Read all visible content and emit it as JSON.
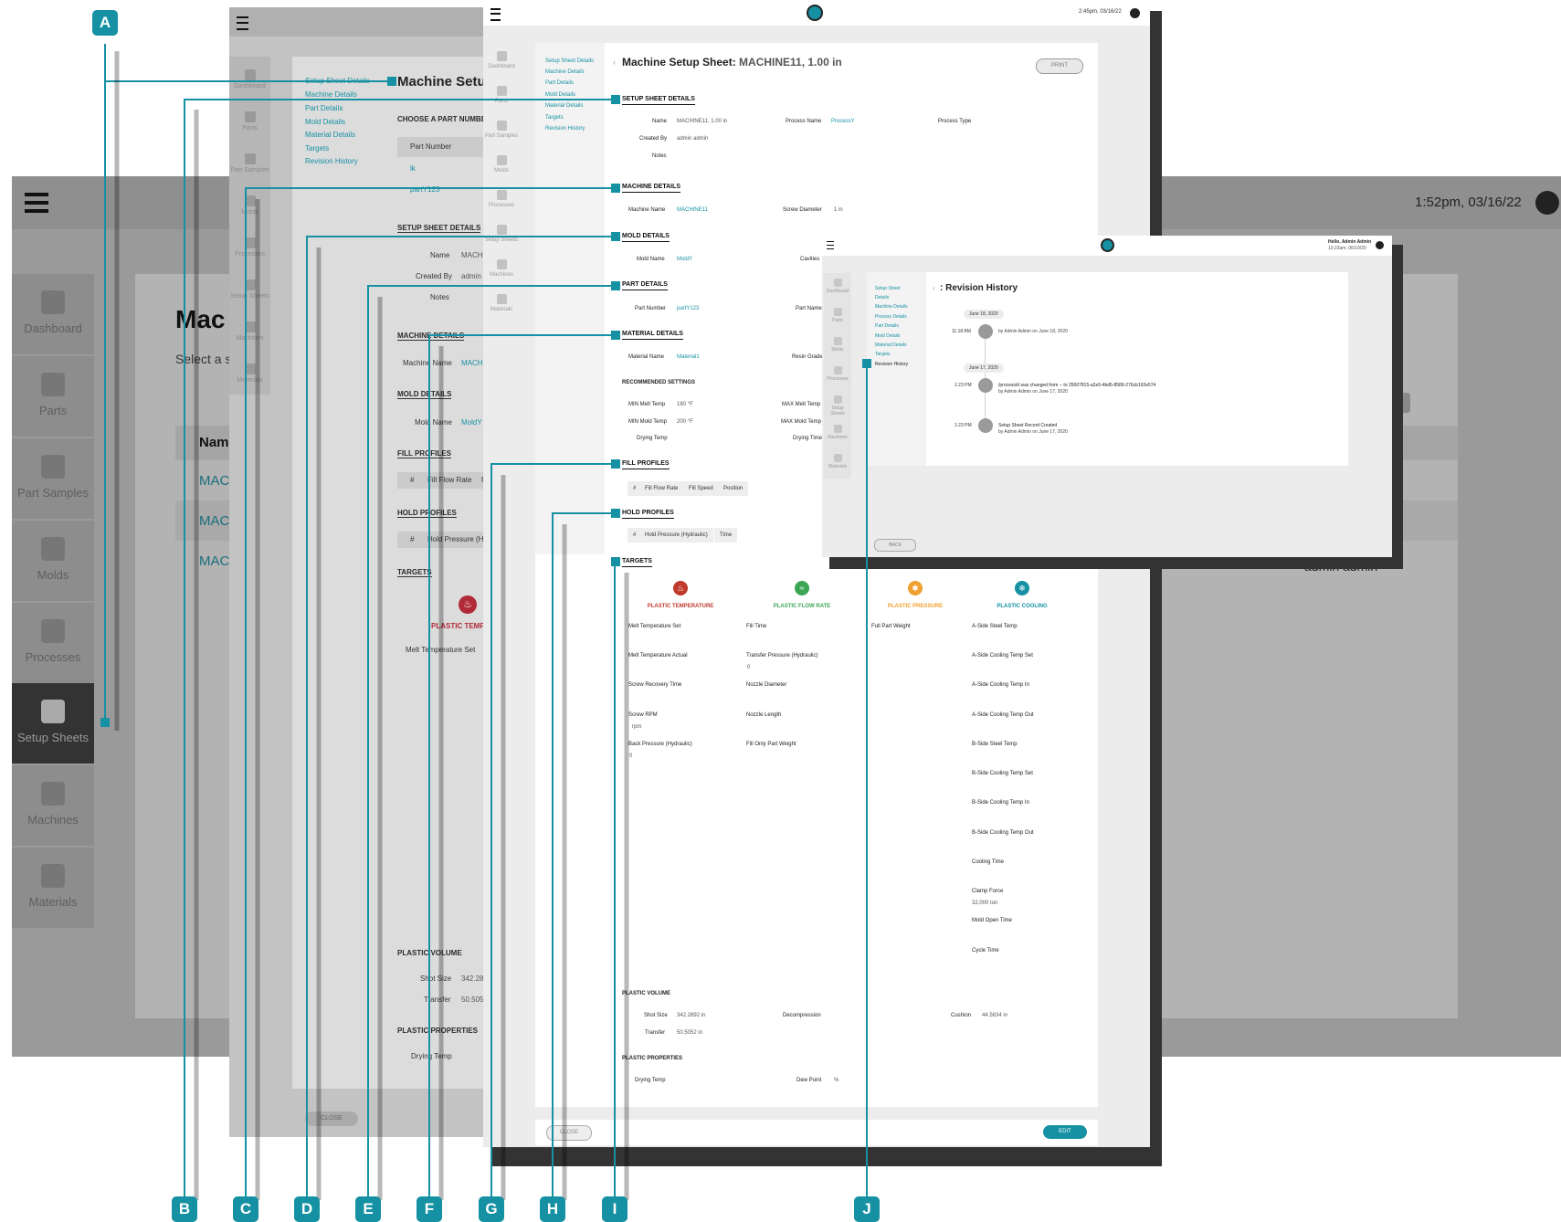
{
  "background_app": {
    "time": "1:52pm, 03/16/22",
    "title_partial": "Mac",
    "subtitle_partial": "Select a s",
    "table_header_partial": "Nam",
    "rows_partial": [
      "MAC",
      "MAC",
      "MAC"
    ],
    "user": "admin admin",
    "nav": [
      "Dashboard",
      "Parts",
      "Part Samples",
      "Molds",
      "Processes",
      "Setup Sheets",
      "Machines",
      "Materials"
    ],
    "active_nav": "Setup Sheets"
  },
  "layer1": {
    "side_nav": [
      "Dashboard",
      "Parts",
      "Part Samples",
      "Molds",
      "Processes",
      "Setup Sheets",
      "Machines",
      "Materials"
    ],
    "nav_links": [
      "Setup Sheet Details",
      "Machine Details",
      "Part Details",
      "Mold Details",
      "Material Details",
      "Targets",
      "Revision History"
    ],
    "title": "Machine Setup",
    "choose_part": "CHOOSE A PART NUMBER",
    "part_number_header": "Part Number",
    "part_rows": [
      "lk",
      "partY123"
    ],
    "sections": {
      "setup": "SETUP SHEET DETAILS",
      "machine": "MACHINE DETAILS",
      "mold": "MOLD DETAILS",
      "fill": "FILL PROFILES",
      "hold": "HOLD PROFILES",
      "targets": "TARGETS",
      "volume": "PLASTIC VOLUME",
      "properties": "PLASTIC PROPERTIES"
    },
    "labels": {
      "name": "Name",
      "name_val": "MACHI",
      "created_by": "Created By",
      "created_by_val": "admin a",
      "notes": "Notes",
      "machine_name": "Machine Name",
      "machine_name_val": "MACHI",
      "mold_name": "Mold Name",
      "mold_name_val": "MoldY",
      "fill_hash": "#",
      "fill_rate": "Fill Flow Rate",
      "fill_more": "F",
      "hold_hash": "#",
      "hold_pressure": "Hold Pressure (Hyd",
      "temp_head": "PLASTIC TEMPER",
      "melt_set": "Melt Temperature Set",
      "shot_size": "Shot Size",
      "shot_size_val": "342.28",
      "transfer": "Transfer",
      "transfer_val": "50.505",
      "drying_temp": "Drying Temp"
    },
    "close": "CLOSE"
  },
  "layer2": {
    "time": "2:45pm, 03/16/22",
    "side_nav": [
      "Dashboard",
      "Parts",
      "Part Samples",
      "Molds",
      "Processes",
      "Setup Sheets",
      "Machines",
      "Materials"
    ],
    "nav_links": [
      "Setup Sheet Details",
      "Machine Details",
      "Part Details",
      "Mold Details",
      "Material Details",
      "Targets",
      "Revision History"
    ],
    "title_prefix": "Machine Setup Sheet:",
    "title_value": "MACHINE11, 1.00 in",
    "print": "PRINT",
    "sections": {
      "setup": "SETUP SHEET DETAILS",
      "machine": "MACHINE DETAILS",
      "mold": "MOLD DETAILS",
      "part": "PART DETAILS",
      "material": "MATERIAL DETAILS",
      "fill": "FILL PROFILES",
      "hold": "HOLD PROFILES",
      "targets": "TARGETS"
    },
    "setup": {
      "name_label": "Name",
      "name_val": "MACHINE11, 1.00 in",
      "process_name_label": "Process Name",
      "process_name_val": "ProcessY",
      "process_type_label": "Process Type",
      "created_by_label": "Created By",
      "created_by_val": "admin admin",
      "notes_label": "Notes"
    },
    "machine": {
      "name_label": "Machine Name",
      "name_val": "MACHINE11",
      "screw_label": "Screw Diameter",
      "screw_val": "1 in"
    },
    "mold": {
      "name_label": "Mold Name",
      "name_val": "MoldY",
      "cavities_label": "Cavities"
    },
    "part": {
      "number_label": "Part Number",
      "number_val": "partY123",
      "name_label": "Part Name"
    },
    "material": {
      "name_label": "Material Name",
      "name_val": "Material1",
      "resin_label": "Resin Grade",
      "recommended": "RECOMMENDED SETTINGS",
      "min_melt_label": "MIN Melt Temp",
      "min_melt_val": "180 °F",
      "max_melt_label": "MAX Melt Temp",
      "min_mold_label": "MIN Mold Temp",
      "min_mold_val": "200 °F",
      "max_mold_label": "MAX Mold Temp",
      "drying_temp_label": "Drying Temp",
      "drying_time_label": "Drying Time"
    },
    "fill_cols": [
      "#",
      "Fill Flow Rate",
      "Fill Speed",
      "Position"
    ],
    "hold_cols": [
      "#",
      "Hold Pressure (Hydraulic)",
      "Time"
    ],
    "targets": {
      "temp_head": "PLASTIC TEMPERATURE",
      "flow_head": "PLASTIC FLOW RATE",
      "pressure_head": "PLASTIC PRESSURE",
      "cooling_head": "PLASTIC COOLING",
      "temp_color": "#c0392b",
      "flow_color": "#3aa655",
      "pressure_color": "#f0a030",
      "cooling_color": "#1591a3",
      "col1": [
        "Melt Temperature Set",
        "Melt Temperature Actual",
        "Screw Recovery Time",
        "Screw RPM",
        "Back Pressure (Hydraulic)"
      ],
      "col1_units": {
        "screw_rpm": "rpm",
        "back_pressure": "0"
      },
      "col2": [
        "Fill Time",
        "Transfer Pressure (Hydraulic)",
        "Nozzle Diameter",
        "Nozzle Length",
        "Fill Only Part Weight"
      ],
      "col2_units": {
        "transfer_pressure": "0"
      },
      "col3": [
        "Full Part Weight"
      ],
      "col4": [
        "A-Side Steel Temp",
        "A-Side Cooling Temp Set",
        "A-Side Cooling Temp In",
        "A-Side Cooling Temp Out",
        "B-Side Steel Temp",
        "B-Side Cooling Temp Set",
        "B-Side Cooling Temp In",
        "B-Side Cooling Temp Out",
        "Cooling Time",
        "Clamp Force",
        "Mold Open Time",
        "Cycle Time"
      ],
      "clamp_force_val": "32,000 ton"
    },
    "volume": {
      "head": "PLASTIC VOLUME",
      "shot_label": "Shot Size",
      "shot_val": "342.2892 in",
      "decompression_label": "Decompression",
      "cushion_label": "Cushion",
      "cushion_val": "44.5634 in",
      "transfer_label": "Transfer",
      "transfer_val": "50.5052 in"
    },
    "properties": {
      "head": "PLASTIC PROPERTIES",
      "drying_label": "Drying Temp",
      "dew_label": "Dew Point",
      "dew_val": "%"
    },
    "close": "CLOSE",
    "edit": "EDIT"
  },
  "layer3": {
    "greeting": "Hello, Admin Admin",
    "time": "10:23am, 06/19/20",
    "side_nav": [
      "Dashboard",
      "Parts",
      "Molds",
      "Processes",
      "Setup Sheets",
      "Machines",
      "Materials"
    ],
    "nav_links": [
      "Setup Sheet",
      "Details",
      "Machine Details",
      "Process Details",
      "Part Details",
      "Mold Details",
      "Material Details",
      "Targets",
      "Revision History"
    ],
    "title": ": Revision History",
    "entries": [
      {
        "date": "June 18, 2020",
        "time": "11:18 AM",
        "text": "",
        "by": "by Admin Admin on June 18, 2020"
      },
      {
        "date": "June 17, 2020",
        "time": "1:23 PM",
        "text": "/processId was changed from -- to 25007815-a2e5-4bd5-8589-276cb192e574",
        "by": "by Admin Admin on June 17, 2020"
      },
      {
        "date": "",
        "time": "1:23 PM",
        "text": "Setup Sheet Record Created",
        "by": "by Admin Admin on June 17, 2020"
      }
    ],
    "back": "BACK"
  },
  "callouts": [
    "A",
    "B",
    "C",
    "D",
    "E",
    "F",
    "G",
    "H",
    "I",
    "J"
  ],
  "accent": "#1591a3"
}
